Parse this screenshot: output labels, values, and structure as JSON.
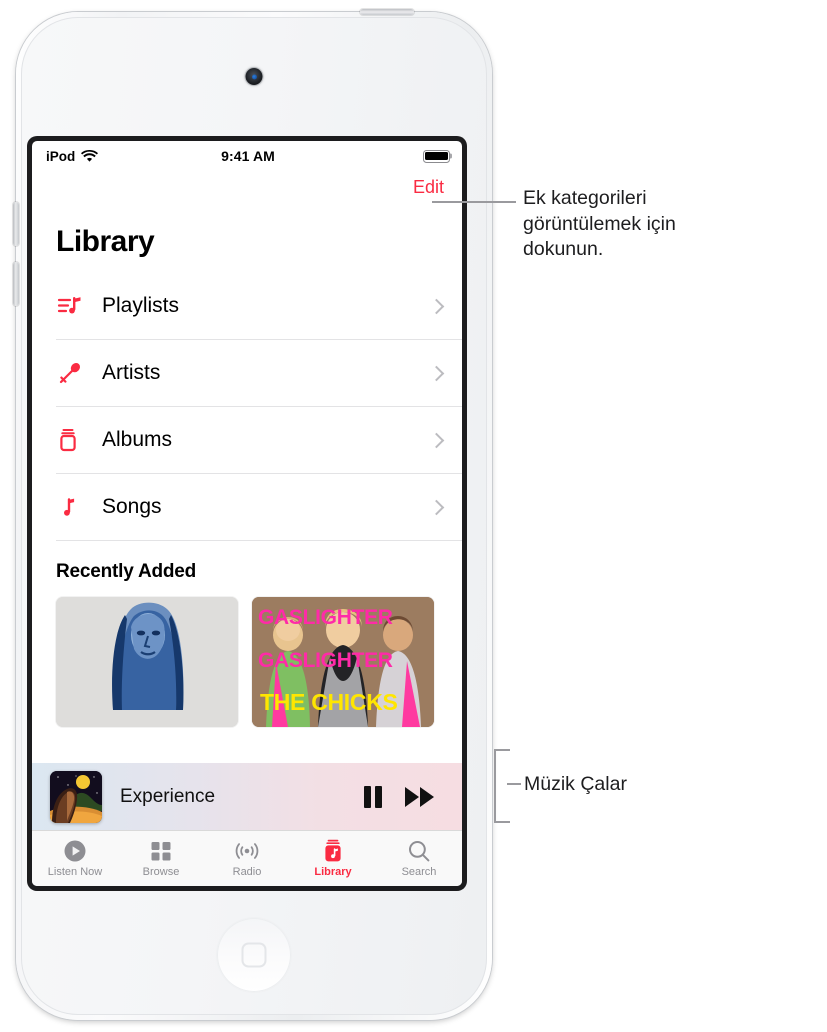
{
  "device": {
    "name": "iPod touch",
    "camera": "front-camera",
    "home_button": "home-button"
  },
  "status_bar": {
    "carrier": "iPod",
    "wifi_icon": "wifi-icon",
    "time": "9:41 AM",
    "battery_icon": "battery-full-icon"
  },
  "nav": {
    "edit_label": "Edit"
  },
  "page_title": "Library",
  "library_rows": [
    {
      "label": "Playlists",
      "icon": "playlist-icon",
      "chevron": "chevron-right-icon"
    },
    {
      "label": "Artists",
      "icon": "microphone-icon",
      "chevron": "chevron-right-icon"
    },
    {
      "label": "Albums",
      "icon": "albums-icon",
      "chevron": "chevron-right-icon"
    },
    {
      "label": "Songs",
      "icon": "music-note-icon",
      "chevron": "chevron-right-icon"
    }
  ],
  "recently_added": {
    "title": "Recently Added",
    "albums": [
      {
        "name": "blue-portrait-artwork",
        "title": "",
        "artist": ""
      },
      {
        "name": "gaslighter-artwork",
        "title": "GASLIGHTER",
        "title_repeat": "GASLIGHTER",
        "artist": "THE CHICKS"
      }
    ]
  },
  "player": {
    "artwork": "moonlit-artwork",
    "track_title": "Experience",
    "pause_label": "pause-button",
    "next_label": "fast-forward-button"
  },
  "tabs": [
    {
      "label": "Listen Now",
      "icon": "listen-now-icon",
      "active": false
    },
    {
      "label": "Browse",
      "icon": "browse-icon",
      "active": false
    },
    {
      "label": "Radio",
      "icon": "radio-icon",
      "active": false
    },
    {
      "label": "Library",
      "icon": "library-icon",
      "active": true
    },
    {
      "label": "Search",
      "icon": "search-icon",
      "active": false
    }
  ],
  "callouts": {
    "edit": "Ek kategorileri görüntülemek için dokunun.",
    "player": "Müzik Çalar"
  },
  "colors": {
    "accent_red": "#fa2b42",
    "inactive_gray": "#8e8e93",
    "separator": "#e3e3e5",
    "leader_gray": "#9a9a9e"
  }
}
